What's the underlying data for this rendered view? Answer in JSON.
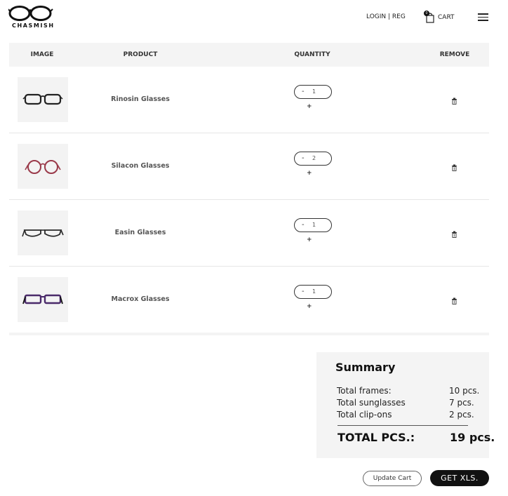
{
  "brand": {
    "name": "CHASMISH"
  },
  "header": {
    "login_label": "LOGIN | REG",
    "cart_label": "CART",
    "cart_count": "0"
  },
  "table": {
    "headers": [
      "IMAGE",
      "PRODUCT",
      "QUANTITY",
      "REMOVE"
    ],
    "rows": [
      {
        "product": "Rinosin Glasses",
        "qty": "1",
        "frame_color": "#222222"
      },
      {
        "product": "Silacon Glasses",
        "qty": "2",
        "frame_color": "#9a3a4a"
      },
      {
        "product": "Easin Glasses",
        "qty": "1",
        "frame_color": "#2a2a2a"
      },
      {
        "product": "Macrox Glasses",
        "qty": "1",
        "frame_color": "#4a2a6a"
      }
    ],
    "minus_label": "-",
    "plus_label": "+"
  },
  "summary": {
    "title": "Summary",
    "lines": [
      {
        "label": "Total frames:",
        "value": "10 pcs."
      },
      {
        "label": "Total sunglasses",
        "value": "7 pcs."
      },
      {
        "label": "Total clip-ons",
        "value": "2 pcs."
      }
    ],
    "total_label": "TOTAL PCS.:",
    "total_value": "19 pcs."
  },
  "buttons": {
    "update_label": "Update Cart",
    "xls_label": "GET XLS."
  }
}
